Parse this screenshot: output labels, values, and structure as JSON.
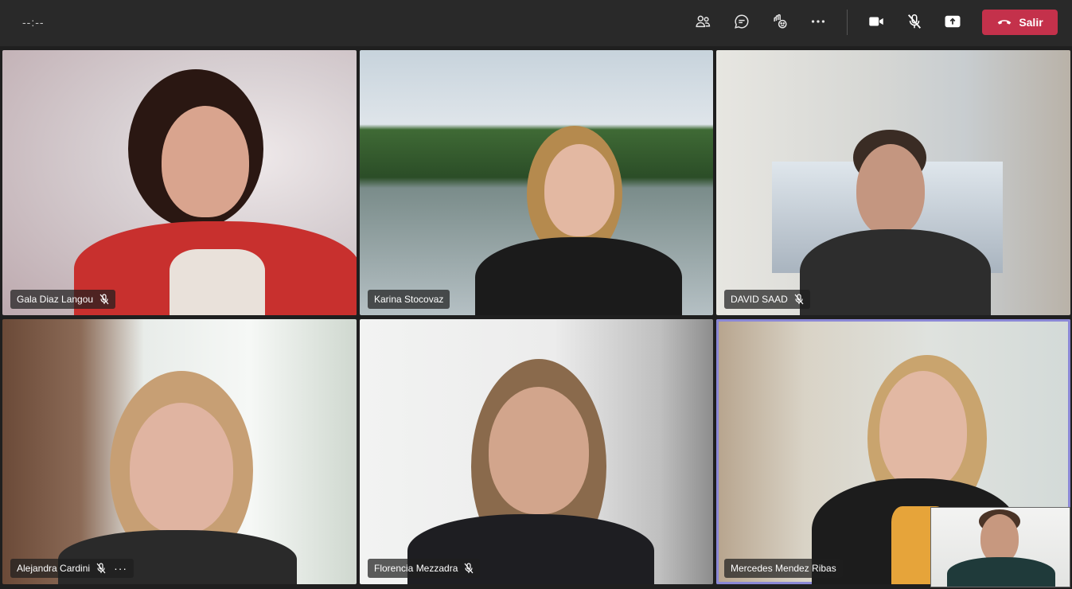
{
  "topbar": {
    "timer": "--:--",
    "icons": [
      "participants-icon",
      "chat-icon",
      "reactions-icon",
      "more-icon",
      "camera-icon",
      "mic-muted-icon",
      "share-icon"
    ],
    "leave_label": "Salir",
    "leave_color": "#c4314b"
  },
  "participants": [
    {
      "name": "Gala Diaz Langou",
      "muted": true
    },
    {
      "name": "Karina Stocovaz",
      "muted": false
    },
    {
      "name": "DAVID SAAD",
      "muted": true
    },
    {
      "name": "Alejandra Cardini",
      "muted": true,
      "more": "···"
    },
    {
      "name": "Florencia Mezzadra",
      "muted": true
    },
    {
      "name": "Mercedes Mendez Ribas",
      "muted": false,
      "active_speaker": true
    }
  ],
  "colors": {
    "topbar": "#292929",
    "grid_bg": "#1f1f1f",
    "active_border": "#8b88d6"
  }
}
